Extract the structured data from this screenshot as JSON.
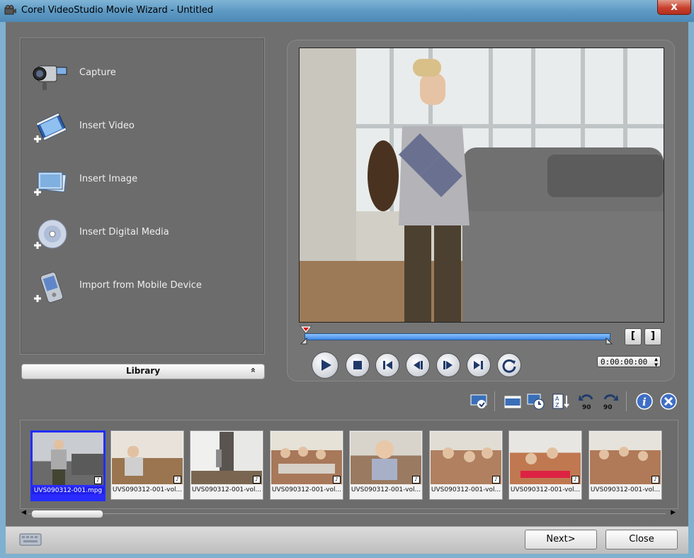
{
  "window": {
    "title": "Corel VideoStudio Movie Wizard - Untitled",
    "close_glyph": "x"
  },
  "left_menu": {
    "items": [
      {
        "label": "Capture",
        "icon": "camcorder-icon"
      },
      {
        "label": "Insert Video",
        "icon": "film-strip-icon"
      },
      {
        "label": "Insert Image",
        "icon": "image-icon"
      },
      {
        "label": "Insert Digital Media",
        "icon": "disc-icon"
      },
      {
        "label": "Import from Mobile Device",
        "icon": "mobile-device-icon"
      }
    ]
  },
  "library_bar": {
    "label": "Library",
    "chevron": "»"
  },
  "preview": {
    "timecode": "0:00:00:00",
    "mark_in": "[",
    "mark_out": "]"
  },
  "library": {
    "items": [
      {
        "caption": "UVS090312-001.mpg",
        "selected": true
      },
      {
        "caption": "UVS090312-001-vol..."
      },
      {
        "caption": "UVS090312-001-vol..."
      },
      {
        "caption": "UVS090312-001-vol..."
      },
      {
        "caption": "UVS090312-001-vol..."
      },
      {
        "caption": "UVS090312-001-vol..."
      },
      {
        "caption": "UVS090312-001-vol..."
      },
      {
        "caption": "UVS090312-001-vol..."
      }
    ],
    "note_glyph": "♪"
  },
  "buttons": {
    "next": "Next>",
    "close": "Close"
  },
  "colors": {
    "accent": "#3c88e8",
    "selection": "#2020e8",
    "panel": "#6f6f6f"
  }
}
